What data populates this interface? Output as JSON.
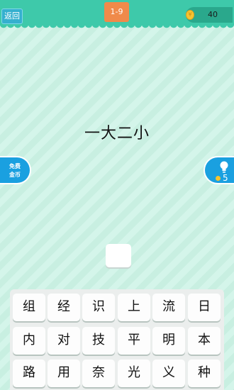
{
  "header": {
    "back_label": "返回",
    "level": "1-9",
    "coins": "40",
    "coin_symbol": "¥"
  },
  "puzzle": {
    "question": "一大二小"
  },
  "side_buttons": {
    "free_coins_line1": "免费",
    "free_coins_line2": "金币",
    "hint_count": "5"
  },
  "keyboard": {
    "rows": [
      [
        "组",
        "经",
        "识",
        "上",
        "流",
        "日"
      ],
      [
        "内",
        "对",
        "技",
        "平",
        "明",
        "本"
      ],
      [
        "路",
        "用",
        "奈",
        "光",
        "义",
        "种"
      ]
    ]
  },
  "colors": {
    "header": "#3ec9aa",
    "accent_blue": "#1aa0e0",
    "level_badge": "#f08a4a",
    "coin": "#f5c431"
  }
}
